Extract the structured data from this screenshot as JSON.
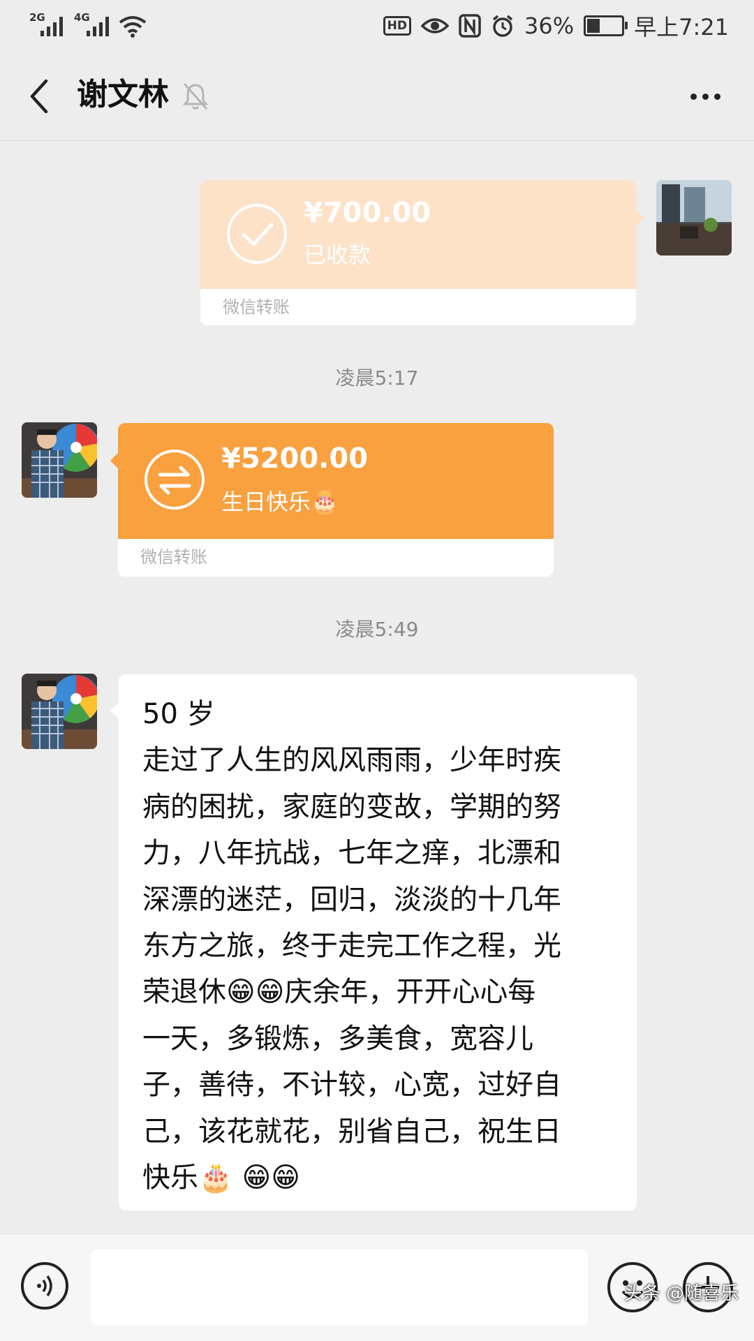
{
  "status_bar": {
    "sig1": "2G",
    "sig2": "4G",
    "battery": "36%",
    "time": "早上7:21",
    "hd": "HD"
  },
  "header": {
    "title": "谢文林"
  },
  "messages": {
    "transfer_sent": {
      "amount": "¥700.00",
      "note": "已收款",
      "footer": "微信转账",
      "color": "#fde2c8"
    },
    "time1": "凌晨5:17",
    "transfer_received": {
      "amount": "¥5200.00",
      "note": "生日快乐🎂",
      "footer": "微信转账",
      "color": "#f9a03f"
    },
    "time2": "凌晨5:49",
    "text": "50 岁\n走过了人生的风风雨雨，少年时疾\n病的困扰，家庭的变故，学期的努\n力，八年抗战，七年之痒，北漂和\n深漂的迷茫，回归，淡淡的十几年\n东方之旅，终于走完工作之程，光\n荣退休😁😁庆余年，开开心心每\n一天，多锻炼，多美食，宽容儿\n子，善待，不计较，心宽，过好自\n己，该花就花，别省自己，祝生日\n快乐🎂 😁😁"
  },
  "watermark": "头条 @随喜乐"
}
